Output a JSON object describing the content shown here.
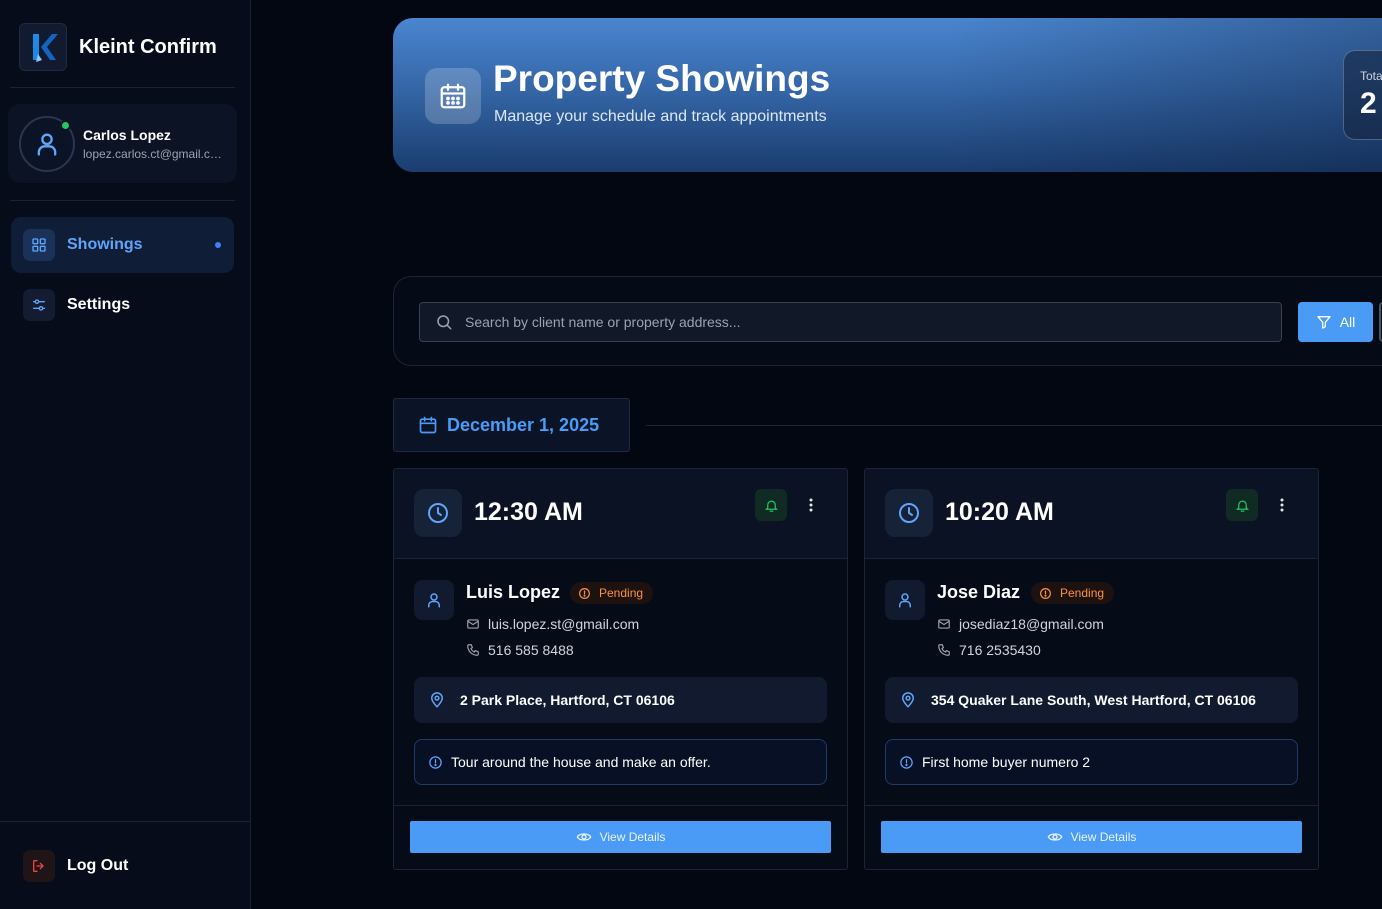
{
  "app": {
    "name": "Kleint Confirm"
  },
  "user": {
    "name": "Carlos Lopez",
    "email": "lopez.carlos.ct@gmail.com"
  },
  "nav": {
    "items": [
      {
        "label": "Showings",
        "icon": "grid-icon",
        "active": true
      },
      {
        "label": "Settings",
        "icon": "sliders-icon",
        "active": false
      }
    ],
    "logout_label": "Log Out"
  },
  "header": {
    "title": "Property Showings",
    "subtitle": "Manage your schedule and track appointments",
    "stat_label": "Total",
    "stat_value": "2"
  },
  "search": {
    "placeholder": "Search by client name or property address...",
    "value": "",
    "filter_label": "All"
  },
  "date_group": {
    "label": "December 1, 2025"
  },
  "showings": [
    {
      "time": "12:30 AM",
      "client": "Luis Lopez",
      "status": "Pending",
      "email": "luis.lopez.st@gmail.com",
      "phone": "516 585 8488",
      "address": "2 Park Place, Hartford, CT 06106",
      "note": "Tour around the house and make an offer.",
      "action_label": "View Details"
    },
    {
      "time": "10:20 AM",
      "client": "Jose Diaz",
      "status": "Pending",
      "email": "josediaz18@gmail.com",
      "phone": "716 2535430",
      "address": "354 Quaker Lane South, West Hartford, CT 06106",
      "note": "First home buyer numero 2",
      "action_label": "View Details"
    }
  ],
  "colors": {
    "accent": "#4a9bf5",
    "pending": "#fb923c",
    "online": "#22c55e",
    "background": "#030712"
  }
}
